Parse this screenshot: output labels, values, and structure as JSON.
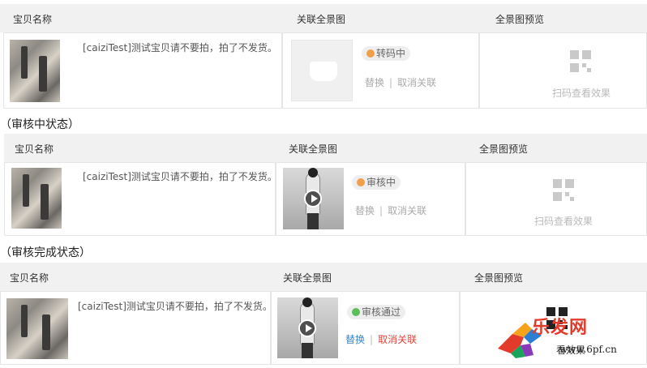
{
  "columns": {
    "name": "宝贝名称",
    "panorama": "关联全景图",
    "preview": "全景图预览"
  },
  "sections": [
    {
      "title": "",
      "item_title": "[caiziTest]测试宝贝请不要拍，拍了不发货。",
      "status": "转码中",
      "status_color": "#f0a04b",
      "replace": "替换",
      "unlink": "取消关联",
      "preview_label": "扫码查看效果"
    },
    {
      "title": "（审核中状态）",
      "item_title": "[caiziTest]测试宝贝请不要拍，拍了不发货。",
      "status": "审核中",
      "status_color": "#f0a04b",
      "replace": "替换",
      "unlink": "取消关联",
      "preview_label": "扫码查看效果"
    },
    {
      "title": "（审核完成状态）",
      "item_title": "[caiziTest]测试宝贝请不要拍，拍了不发货。",
      "status": "审核通过",
      "status_color": "#5cbf5a",
      "replace": "替换",
      "unlink": "取消关联",
      "preview_label": "看效果"
    }
  ],
  "colors": {
    "link_blue": "#3a86c8",
    "link_red": "#e0433b",
    "disabled_gray": "#aaaaaa"
  },
  "watermark": {
    "brand": "乐发网",
    "site": "www.6pf.cn"
  }
}
